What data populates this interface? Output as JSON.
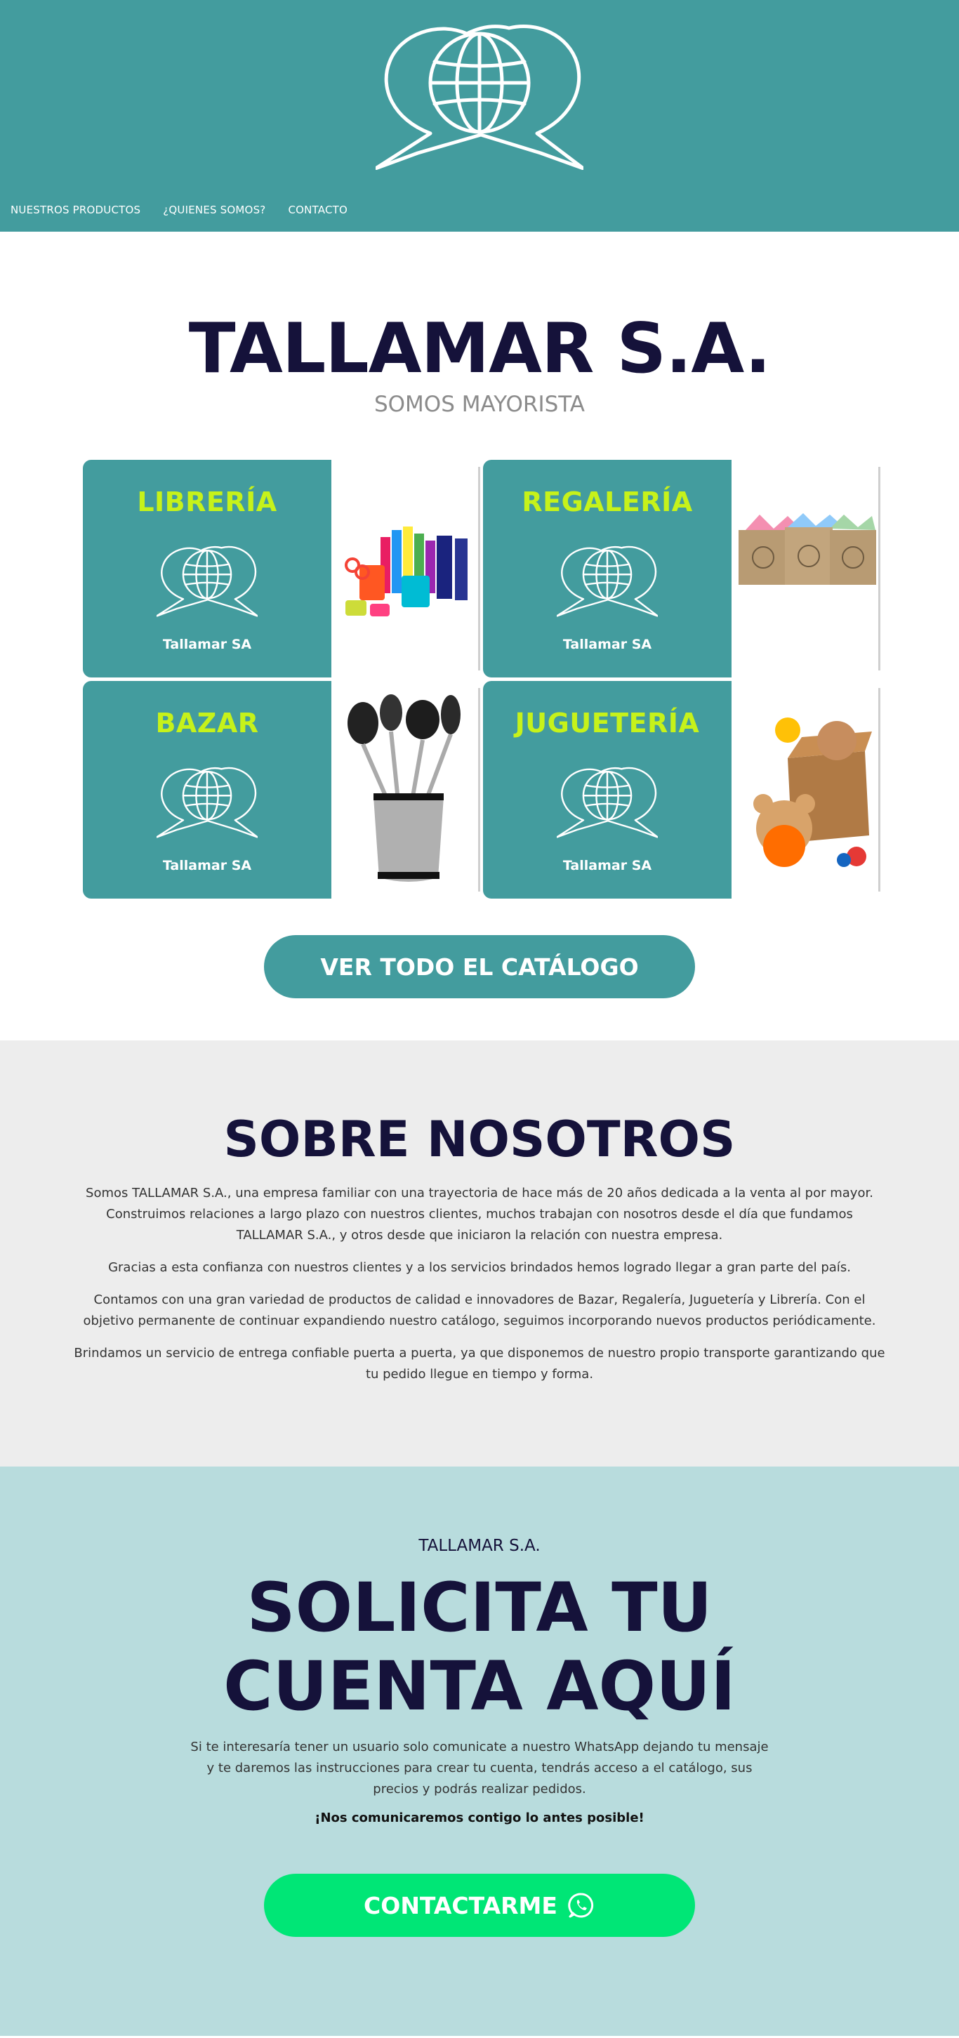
{
  "header": {
    "logo_icon": "globe-speech-bubbles-icon",
    "nav": [
      {
        "label": "NUESTROS PRODUCTOS"
      },
      {
        "label": "¿QUIENES SOMOS?"
      },
      {
        "label": "CONTACTO"
      }
    ]
  },
  "hero": {
    "title": "TALLAMAR S.A.",
    "subtitle": "SOMOS MAYORISTA"
  },
  "categories": [
    {
      "title": "LIBRERÍA",
      "brand": "Tallamar SA",
      "image": "stationery-supplies"
    },
    {
      "title": "REGALERÍA",
      "brand": "Tallamar SA",
      "image": "gift-bags"
    },
    {
      "title": "BAZAR",
      "brand": "Tallamar SA",
      "image": "kitchen-utensils"
    },
    {
      "title": "JUGUETERÍA",
      "brand": "Tallamar SA",
      "image": "toys-box"
    }
  ],
  "catalog_button": "VER TODO EL CATÁLOGO",
  "about": {
    "title": "SOBRE NOSOTROS",
    "paragraphs": [
      "Somos TALLAMAR S.A., una empresa familiar con una trayectoria de hace más de 20 años dedicada a la venta al por mayor. Construimos relaciones a largo plazo con nuestros clientes, muchos trabajan con nosotros desde el día que fundamos TALLAMAR S.A., y otros desde que iniciaron la relación con nuestra empresa.",
      "Gracias a esta confianza con nuestros clientes y a los servicios brindados hemos logrado llegar a gran parte del país.",
      "Contamos con una gran variedad de productos de calidad e innovadores de Bazar, Regalería, Juguetería y Librería. Con el objetivo permanente de continuar expandiendo nuestro catálogo, seguimos incorporando nuevos productos periódicamente.",
      "Brindamos un servicio de entrega confiable puerta a puerta, ya que disponemos de nuestro propio transporte garantizando que tu pedido llegue en tiempo y forma."
    ]
  },
  "signup": {
    "eyebrow": "TALLAMAR S.A.",
    "title_line1": "SOLICITA TU",
    "title_line2": "CUENTA AQUÍ",
    "text": "Si te interesaría tener un usuario solo comunicate a nuestro WhatsApp dejando tu mensaje y te daremos las instrucciones para crear tu cuenta, tendrás acceso a el catálogo, sus precios y podrás realizar pedidos.",
    "note": "¡Nos comunicaremos contigo lo antes posible!",
    "button": "CONTACTARME",
    "button_icon": "whatsapp-icon"
  },
  "colors": {
    "teal": "#439c9e",
    "navy": "#15123a",
    "lime": "#c6f21a",
    "light_gray": "#ededed",
    "light_teal": "#b8dcdd",
    "whatsapp_green": "#00e676"
  }
}
